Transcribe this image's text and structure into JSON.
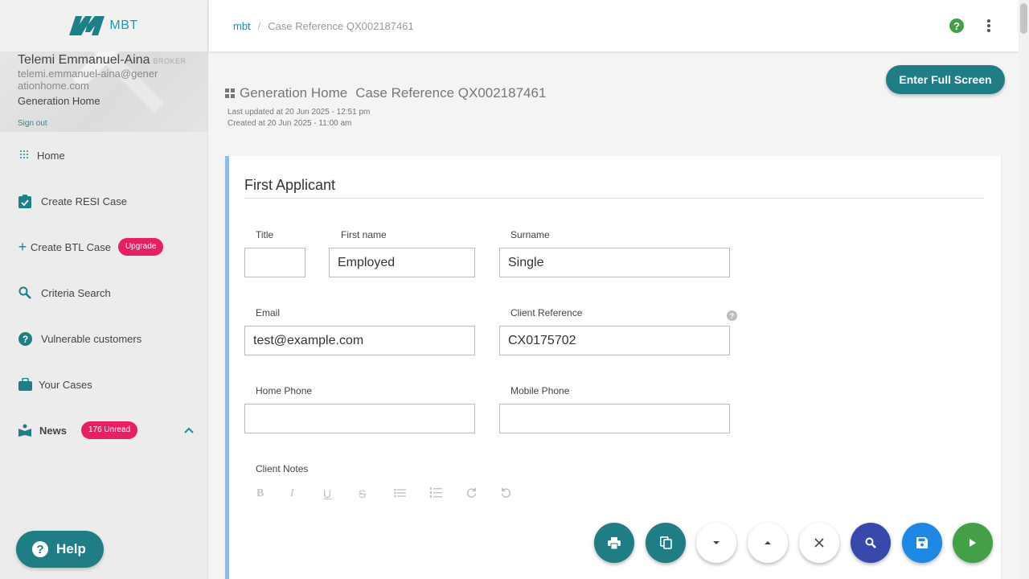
{
  "app": {
    "logo_text": "MBT",
    "brand_color": "#1e9bb0"
  },
  "user": {
    "name": "Telemi Emmanuel-Aina",
    "role": "BROKER",
    "email": "telemi.emmanuel-aina@generationhome.com",
    "organization": "Generation Home",
    "sign_out": "Sign out"
  },
  "nav": {
    "items": [
      {
        "label": "Home",
        "icon": "grid-dots-icon"
      },
      {
        "label": "Create RESI Case",
        "icon": "clipboard-check-icon"
      },
      {
        "label": "Create BTL Case",
        "icon": "plus-icon",
        "badge": "Upgrade"
      },
      {
        "label": "Criteria Search",
        "icon": "search-icon"
      },
      {
        "label": "Vulnerable customers",
        "icon": "help-circle-icon"
      },
      {
        "label": "Your Cases",
        "icon": "briefcase-icon"
      },
      {
        "label": "News",
        "icon": "book-reader-icon",
        "badge": "176 Unread"
      }
    ]
  },
  "help_button": "Help",
  "breadcrumb": {
    "root": "mbt",
    "current": "Case Reference QX002187461"
  },
  "header": {
    "full_screen_button": "Enter Full Screen",
    "company": "Generation Home",
    "case_reference": "Case Reference QX002187461",
    "last_updated": "Last updated at 20 Jun 2025 - 12:51 pm",
    "created": "Created at 20 Jun 2025 - 11:00 am"
  },
  "form": {
    "section_title": "First Applicant",
    "fields": {
      "title": {
        "label": "Title",
        "value": ""
      },
      "first_name": {
        "label": "First name",
        "value": "Employed"
      },
      "surname": {
        "label": "Surname",
        "value": "Single"
      },
      "email": {
        "label": "Email",
        "value": "test@example.com"
      },
      "client_reference": {
        "label": "Client Reference",
        "value": "CX0175702"
      },
      "home_phone": {
        "label": "Home Phone",
        "value": ""
      },
      "mobile_phone": {
        "label": "Mobile Phone",
        "value": ""
      },
      "client_notes": {
        "label": "Client Notes"
      }
    },
    "editor_toolbar": [
      "bold-icon",
      "italic-icon",
      "underline-icon",
      "strikethrough-icon",
      "bullet-list-icon",
      "numbered-list-icon",
      "redo-icon",
      "undo-icon"
    ]
  },
  "colors": {
    "teal": "#1f7d86",
    "pink_badge": "#e91e63",
    "indigo": "#3949ab",
    "blue": "#1e88e5",
    "green": "#43a047",
    "card_accent": "#8fbbe8"
  },
  "fabs": [
    "print-icon",
    "copy-icon",
    "expand-down-icon",
    "collapse-up-icon",
    "close-icon",
    "search-icon",
    "save-icon",
    "play-icon"
  ]
}
